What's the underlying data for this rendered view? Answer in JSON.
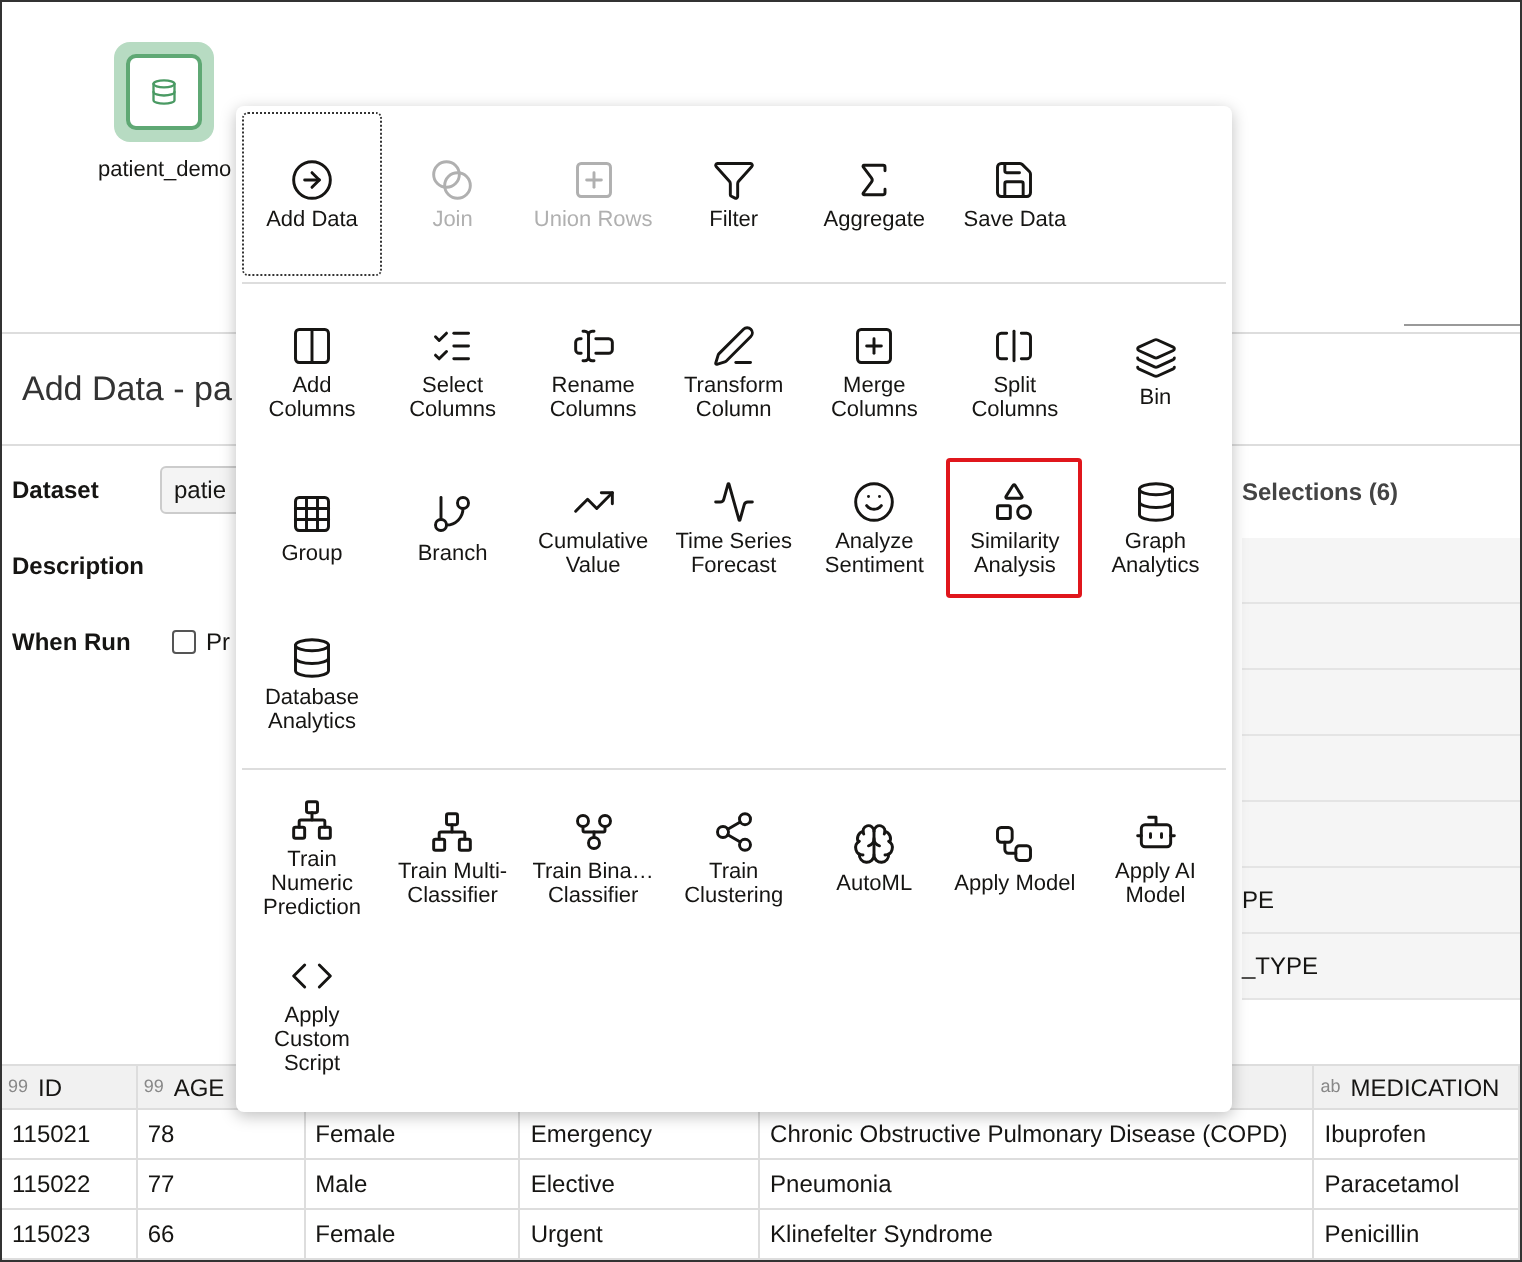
{
  "canvas": {
    "node": {
      "label": "patient_demo"
    }
  },
  "panel": {
    "title": "Add Data - pa",
    "fields": [
      {
        "kind": "select",
        "label": "Dataset",
        "value": "patie"
      },
      {
        "kind": "text",
        "label": "Description"
      },
      {
        "kind": "checkbox",
        "label": "When Run",
        "option": "Pr",
        "checked": false
      }
    ],
    "side_tab": "Selections (6)",
    "side_rows": [
      {
        "text": "PE"
      },
      {
        "text": "_TYPE"
      }
    ]
  },
  "table": {
    "columns": [
      {
        "type_mark": "99",
        "label": "ID"
      },
      {
        "type_mark": "99",
        "label": "AGE"
      },
      {},
      {},
      {},
      {
        "type_mark": "ab",
        "label": "MEDICATION"
      }
    ],
    "rows": [
      [
        "115021",
        "78",
        "Female",
        "Emergency",
        "Chronic Obstructive Pulmonary Disease (COPD)",
        "Ibuprofen"
      ],
      [
        "115022",
        "77",
        "Male",
        "Elective",
        "Pneumonia",
        "Paracetamol"
      ],
      [
        "115023",
        "66",
        "Female",
        "Urgent",
        "Klinefelter Syndrome",
        "Penicillin"
      ]
    ]
  },
  "menu": {
    "sections": [
      {
        "items": [
          {
            "label": "Add Data",
            "selected": true,
            "disabled": false,
            "highlighted": false
          },
          {
            "label": "Join",
            "selected": false,
            "disabled": true,
            "highlighted": false
          },
          {
            "label": "Union Rows",
            "selected": false,
            "disabled": true,
            "highlighted": false
          },
          {
            "label": "Filter",
            "selected": false,
            "disabled": false,
            "highlighted": false
          },
          {
            "label": "Aggregate",
            "selected": false,
            "disabled": false,
            "highlighted": false
          },
          {
            "label": "Save Data",
            "selected": false,
            "disabled": false,
            "highlighted": false
          }
        ]
      },
      {
        "items": [
          {
            "label": "Add Columns",
            "selected": false,
            "disabled": false,
            "highlighted": false
          },
          {
            "label": "Select Columns",
            "selected": false,
            "disabled": false,
            "highlighted": false
          },
          {
            "label": "Rename Columns",
            "selected": false,
            "disabled": false,
            "highlighted": false
          },
          {
            "label": "Transform Column",
            "selected": false,
            "disabled": false,
            "highlighted": false
          },
          {
            "label": "Merge Columns",
            "selected": false,
            "disabled": false,
            "highlighted": false
          },
          {
            "label": "Split Columns",
            "selected": false,
            "disabled": false,
            "highlighted": false
          },
          {
            "label": "Bin",
            "selected": false,
            "disabled": false,
            "highlighted": false
          },
          {
            "label": "Group",
            "selected": false,
            "disabled": false,
            "highlighted": false
          },
          {
            "label": "Branch",
            "selected": false,
            "disabled": false,
            "highlighted": false
          },
          {
            "label": "Cumulative Value",
            "selected": false,
            "disabled": false,
            "highlighted": false
          },
          {
            "label": "Time Series Forecast",
            "selected": false,
            "disabled": false,
            "highlighted": false
          },
          {
            "label": "Analyze Sentiment",
            "selected": false,
            "disabled": false,
            "highlighted": false
          },
          {
            "label": "Similarity Analysis",
            "selected": false,
            "disabled": false,
            "highlighted": true
          },
          {
            "label": "Graph Analytics",
            "selected": false,
            "disabled": false,
            "highlighted": false
          },
          {
            "label": "Database Analytics",
            "selected": false,
            "disabled": false,
            "highlighted": false
          }
        ]
      },
      {
        "items": [
          {
            "label": "Train Numeric Prediction",
            "selected": false,
            "disabled": false,
            "highlighted": false
          },
          {
            "label": "Train Multi-Classifier",
            "selected": false,
            "disabled": false,
            "highlighted": false
          },
          {
            "label": "Train Bina…Classifier",
            "selected": false,
            "disabled": false,
            "highlighted": false
          },
          {
            "label": "Train Clustering",
            "selected": false,
            "disabled": false,
            "highlighted": false
          },
          {
            "label": "AutoML",
            "selected": false,
            "disabled": false,
            "highlighted": false
          },
          {
            "label": "Apply Model",
            "selected": false,
            "disabled": false,
            "highlighted": false
          },
          {
            "label": "Apply AI Model",
            "selected": false,
            "disabled": false,
            "highlighted": false
          },
          {
            "label": "Apply Custom Script",
            "selected": false,
            "disabled": false,
            "highlighted": false
          }
        ]
      }
    ]
  }
}
